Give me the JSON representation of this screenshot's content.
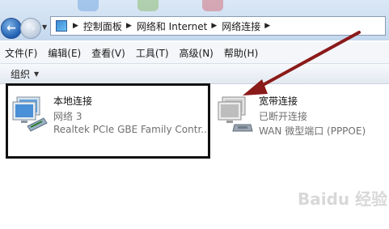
{
  "breadcrumb": {
    "items": [
      "控制面板",
      "网络和 Internet",
      "网络连接"
    ],
    "separator": "▶"
  },
  "menu": [
    "文件(F)",
    "编辑(E)",
    "查看(V)",
    "工具(T)",
    "高级(N)",
    "帮助(H)"
  ],
  "command_bar": {
    "organize": "组织",
    "caret": "▼"
  },
  "connections": [
    {
      "name": "本地连接",
      "status": "网络  3",
      "device": "Realtek PCIe GBE Family Contr...",
      "icon": "local-network-icon",
      "selected": true
    },
    {
      "name": "宽带连接",
      "status": "已断开连接",
      "device": "WAN 微型端口 (PPPOE)",
      "icon": "broadband-icon",
      "selected": false
    }
  ],
  "annotation_color": "#8b1a1a",
  "highlight_color": "#111111",
  "watermark": "Baidu 经验"
}
